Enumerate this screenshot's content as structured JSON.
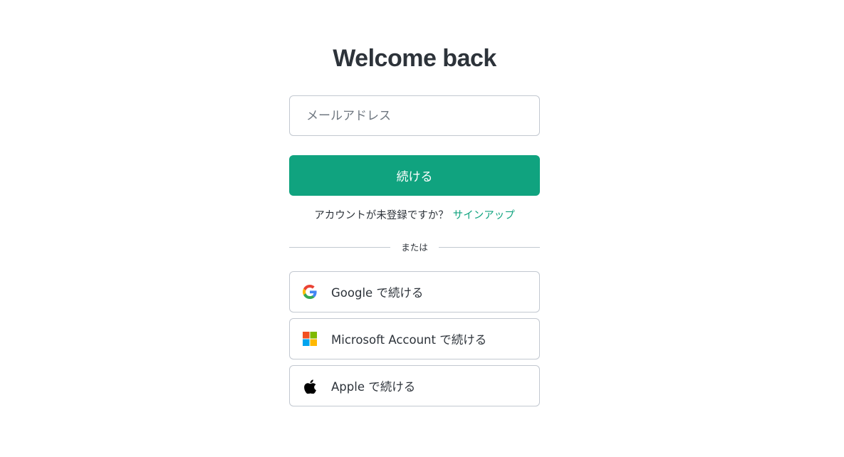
{
  "login": {
    "title": "Welcome back",
    "email_placeholder": "メールアドレス",
    "email_value": "",
    "continue_label": "続ける",
    "signup_prompt": "アカウントが未登録ですか？",
    "signup_link": "サインアップ",
    "divider_text": "または",
    "social": [
      {
        "label": "Google で続ける",
        "icon": "google-icon"
      },
      {
        "label": "Microsoft Account で続ける",
        "icon": "microsoft-icon"
      },
      {
        "label": "Apple で続ける",
        "icon": "apple-icon"
      }
    ]
  },
  "colors": {
    "accent": "#10a37f",
    "text": "#2d333a",
    "border": "#c2c8d0",
    "placeholder": "#6f7780",
    "google_blue": "#4285F4",
    "google_red": "#EA4335",
    "google_yellow": "#FBBC05",
    "google_green": "#34A853",
    "ms_red": "#F25022",
    "ms_green": "#7FBA00",
    "ms_blue": "#00A4EF",
    "ms_yellow": "#FFB900"
  }
}
